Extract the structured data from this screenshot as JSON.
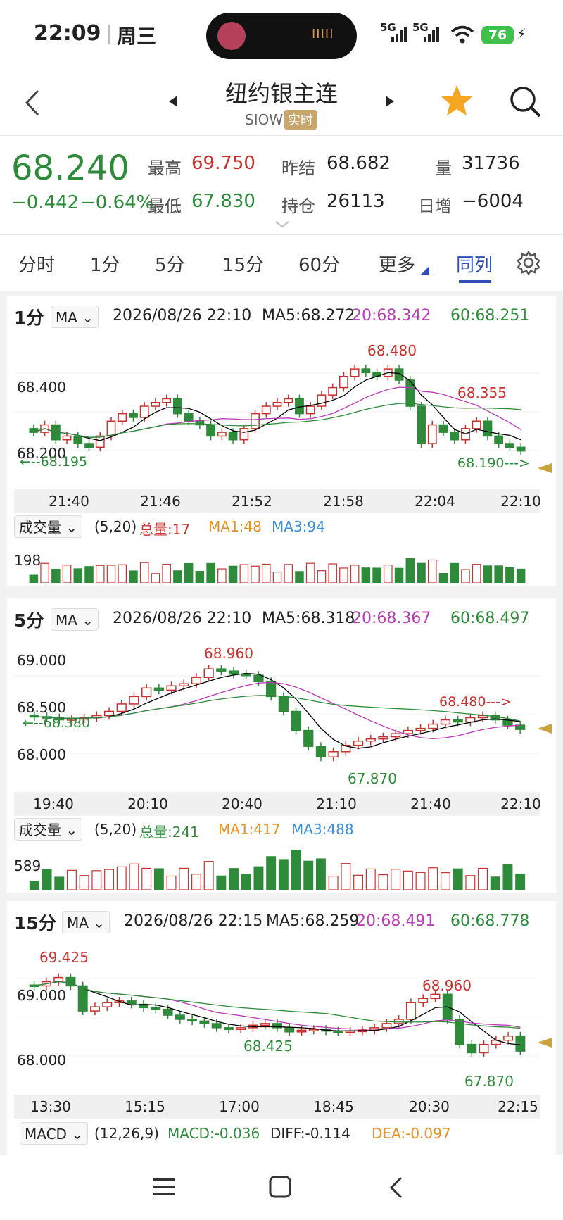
{
  "status": {
    "time": "22:09",
    "day": "周三",
    "signal1": "5G",
    "signal2": "5G",
    "battery": "76",
    "pill_text": "IIIII"
  },
  "header": {
    "title": "纽约银主连",
    "code": "SIOW",
    "badge": "实时"
  },
  "quote": {
    "price": "68.240",
    "change": "−0.442",
    "change_pct": "−0.64%",
    "high_label": "最高",
    "high": "69.750",
    "low_label": "最低",
    "low": "67.830",
    "prev_label": "昨结",
    "prev": "68.682",
    "oi_label": "持仓",
    "oi": "26113",
    "vol_label": "量",
    "vol": "31736",
    "daily_label": "日增",
    "daily": "−6004"
  },
  "tabs": [
    "分时",
    "1分",
    "5分",
    "15分",
    "60分",
    "更多",
    "同列"
  ],
  "colors": {
    "up": "#c8322d",
    "down": "#2e8b3a",
    "ma5": "#000000",
    "ma20": "#b83cb5",
    "ma60": "#2e8b3a",
    "accent": "#2f4fb5",
    "star": "#f5a623"
  },
  "p1": {
    "title": "1分",
    "ind": "MA",
    "time": "2026/08/26 22:10",
    "ma5": "MA5:68.272",
    "ma20": "20:68.342",
    "ma60": "60:68.251",
    "y_labels": [
      "68.400",
      "68.200"
    ],
    "ann_high": "68.480",
    "ann_right": "68.355",
    "ann_left": "←--68.195",
    "ann_rlow": "68.190--->",
    "x_labels": [
      "21:40",
      "21:46",
      "21:52",
      "21:58",
      "22:04",
      "22:10"
    ],
    "vol_sel": "成交量",
    "vol_params": "(5,20)",
    "vol_total": "总量:17",
    "vol_ma1": "MA1:48",
    "vol_ma3": "MA3:94",
    "vol_y": "198"
  },
  "p2": {
    "title": "5分",
    "ind": "MA",
    "time": "2026/08/26 22:10",
    "ma5": "MA5:68.318",
    "ma20": "20:68.367",
    "ma60": "60:68.497",
    "y_labels": [
      "69.000",
      "68.500",
      "68.000"
    ],
    "ann_high": "68.960",
    "ann_right": "68.480--->",
    "ann_left": "←--68.380",
    "ann_low": "67.870",
    "x_labels": [
      "19:40",
      "20:10",
      "20:40",
      "21:10",
      "21:40",
      "22:10"
    ],
    "vol_sel": "成交量",
    "vol_params": "(5,20)",
    "vol_total": "总量:241",
    "vol_ma1": "MA1:417",
    "vol_ma3": "MA3:488",
    "vol_y": "589"
  },
  "p3": {
    "title": "15分",
    "ind": "MA",
    "time": "2026/08/26 22:15",
    "ma5": "MA5:68.259",
    "ma20": "20:68.491",
    "ma60": "60:68.778",
    "y_labels": [
      "69.000",
      "68.000"
    ],
    "ann_high": "69.425",
    "ann_mid": "68.425",
    "ann_right": "68.960",
    "ann_low": "67.870",
    "x_labels": [
      "13:30",
      "15:15",
      "17:00",
      "18:45",
      "20:30",
      "22:15"
    ],
    "macd_sel": "MACD",
    "macd_params": "(12,26,9)",
    "macd": "MACD:-0.036",
    "diff": "DIFF:-0.114",
    "dea": "DEA:-0.097"
  },
  "chart_data": [
    {
      "type": "candlestick",
      "title": "1分",
      "ylim": [
        68.15,
        68.52
      ],
      "x": [
        "21:40",
        "21:46",
        "21:52",
        "21:58",
        "22:04",
        "22:10"
      ],
      "close": [
        68.28,
        68.3,
        68.26,
        68.27,
        68.25,
        68.24,
        68.27,
        68.31,
        68.33,
        68.32,
        68.35,
        68.36,
        68.37,
        68.33,
        68.31,
        68.3,
        68.27,
        68.28,
        68.26,
        68.29,
        68.33,
        68.35,
        68.36,
        68.37,
        68.33,
        68.35,
        68.38,
        68.4,
        68.43,
        68.45,
        68.44,
        68.43,
        68.45,
        68.42,
        68.35,
        68.25,
        68.3,
        68.28,
        68.26,
        68.29,
        68.31,
        68.27,
        68.25,
        68.24,
        68.23
      ]
    },
    {
      "type": "candlestick",
      "title": "5分",
      "ylim": [
        67.8,
        69.1
      ],
      "x": [
        "19:40",
        "20:10",
        "20:40",
        "21:10",
        "21:40",
        "22:10"
      ],
      "close": [
        68.43,
        68.42,
        68.4,
        68.41,
        68.42,
        68.44,
        68.48,
        68.55,
        68.62,
        68.7,
        68.68,
        68.72,
        68.74,
        68.8,
        68.88,
        68.86,
        68.83,
        68.82,
        68.76,
        68.62,
        68.48,
        68.3,
        68.15,
        68.05,
        68.1,
        68.16,
        68.2,
        68.22,
        68.24,
        68.27,
        68.3,
        68.32,
        68.36,
        68.4,
        68.38,
        68.42,
        68.44,
        68.4,
        68.35,
        68.31
      ]
    },
    {
      "type": "candlestick",
      "title": "15分",
      "ylim": [
        67.8,
        69.45
      ],
      "x": [
        "13:30",
        "15:15",
        "17:00",
        "18:45",
        "20:30",
        "22:15"
      ],
      "close": [
        69.0,
        69.05,
        69.1,
        69.0,
        68.7,
        68.75,
        68.8,
        68.82,
        68.78,
        68.74,
        68.72,
        68.65,
        68.6,
        68.58,
        68.55,
        68.5,
        68.48,
        68.5,
        68.53,
        68.55,
        68.5,
        68.45,
        68.47,
        68.48,
        68.46,
        68.45,
        68.46,
        68.47,
        68.5,
        68.55,
        68.6,
        68.8,
        68.85,
        68.9,
        68.6,
        68.3,
        68.2,
        68.3,
        68.35,
        68.4,
        68.22
      ]
    }
  ]
}
